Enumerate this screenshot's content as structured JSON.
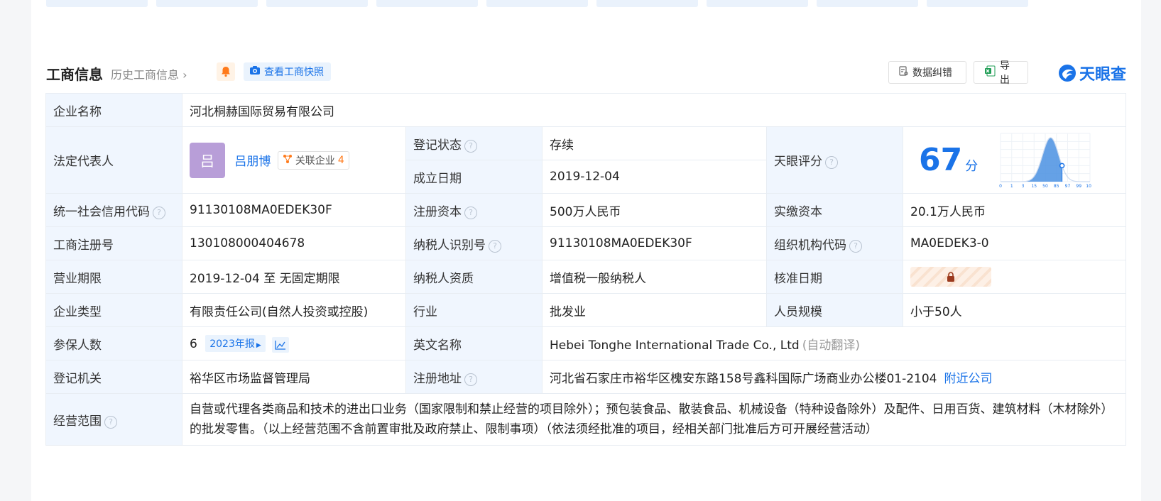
{
  "header": {
    "title": "工商信息",
    "history_link": "历史工商信息",
    "snapshot_button": "查看工商快照",
    "correction_button": "数据纠错",
    "export_button": "导出",
    "logo_text": "天眼查"
  },
  "company": {
    "name_label": "企业名称",
    "name": "河北桐赫国际贸易有限公司",
    "legal_rep_label": "法定代表人",
    "legal_rep_avatar": "吕",
    "legal_rep_name": "吕朋博",
    "related_label": "关联企业",
    "related_count": "4",
    "reg_status_label": "登记状态",
    "reg_status": "存续",
    "founded_label": "成立日期",
    "founded": "2019-12-04",
    "score_label": "天眼评分",
    "score": "67",
    "score_unit": "分",
    "credit_code_label": "统一社会信用代码",
    "credit_code": "91130108MA0EDEK30F",
    "reg_capital_label": "注册资本",
    "reg_capital": "500万人民币",
    "paid_capital_label": "实缴资本",
    "paid_capital": "20.1万人民币",
    "reg_no_label": "工商注册号",
    "reg_no": "130108000404678",
    "taxpayer_id_label": "纳税人识别号",
    "taxpayer_id": "91130108MA0EDEK30F",
    "org_code_label": "组织机构代码",
    "org_code": "MA0EDEK3-0",
    "term_label": "营业期限",
    "term": "2019-12-04 至 无固定期限",
    "tax_qual_label": "纳税人资质",
    "tax_qual": "增值税一般纳税人",
    "approve_label": "核准日期",
    "type_label": "企业类型",
    "type": "有限责任公司(自然人投资或控股)",
    "industry_label": "行业",
    "industry": "批发业",
    "staff_label": "人员规模",
    "staff": "小于50人",
    "insured_label": "参保人数",
    "insured": "6",
    "insured_report": "2023年报",
    "english_label": "英文名称",
    "english": "Hebei Tonghe International Trade Co., Ltd",
    "english_note": "(自动翻译)",
    "authority_label": "登记机关",
    "authority": "裕华区市场监督管理局",
    "address_label": "注册地址",
    "address": "河北省石家庄市裕华区槐安东路158号鑫科国际广场商业办公楼01-2104",
    "nearby_link": "附近公司",
    "scope_label": "经营范围",
    "scope": "自营或代理各类商品和技术的进出口业务（国家限制和禁止经营的项目除外）；预包装食品、散装食品、机械设备（特种设备除外）及配件、日用百货、建筑材料（木材除外）的批发零售。（以上经营范围不含前置审批及政府禁止、限制事项）（依法须经批准的项目，经相关部门批准后方可开展经营活动）"
  },
  "score_chart": {
    "ticks": [
      "0",
      "1",
      "3",
      "15",
      "50",
      "85",
      "97",
      "99",
      "100"
    ],
    "marker_value": 67
  },
  "colors": {
    "accent": "#1a73e8",
    "status_green": "#2aa84a",
    "label_bg": "#f0f6fe",
    "warning_orange": "#ff7a1a"
  }
}
